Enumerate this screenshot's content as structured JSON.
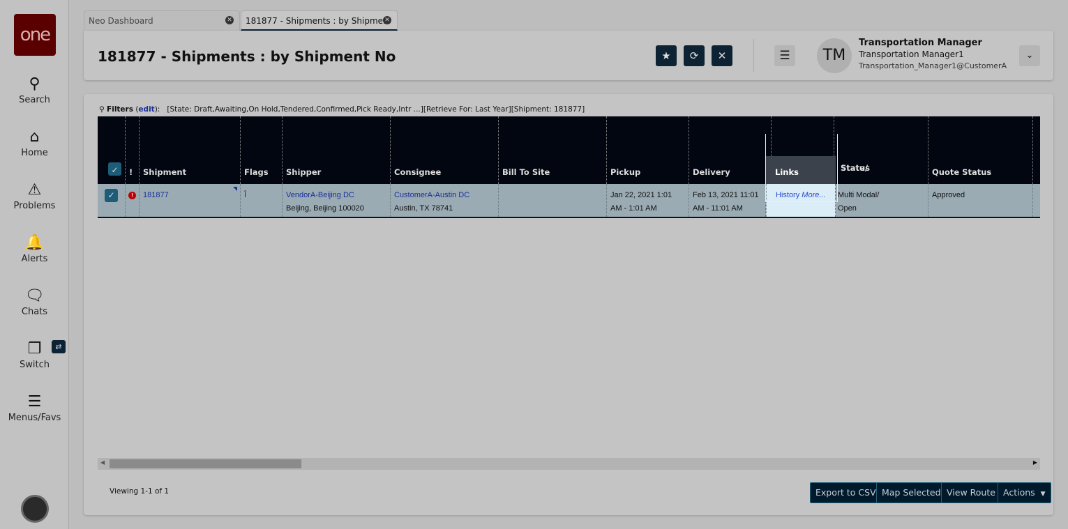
{
  "logo": "one",
  "sidebar": {
    "items": [
      {
        "label": "Search",
        "icon": "search-icon"
      },
      {
        "label": "Home",
        "icon": "home-icon"
      },
      {
        "label": "Problems",
        "icon": "warning-icon"
      },
      {
        "label": "Alerts",
        "icon": "bell-icon"
      },
      {
        "label": "Chats",
        "icon": "chat-icon"
      },
      {
        "label": "Switch",
        "icon": "switch-icon"
      },
      {
        "label": "Menus/Favs",
        "icon": "menu-icon"
      }
    ]
  },
  "tabs": [
    {
      "label": "Neo Dashboard"
    },
    {
      "label": "181877 - Shipments : by Shipme..."
    }
  ],
  "header": {
    "title": "181877 - Shipments : by Shipment No",
    "user": {
      "initials": "TM",
      "name": "Transportation Manager",
      "role": "Transportation Manager1",
      "email": "Transportation_Manager1@CustomerA"
    }
  },
  "filters": {
    "label": "Filters",
    "edit": "edit",
    "text": "[State: Draft,Awaiting,On Hold,Tendered,Confirmed,Pick Ready,Intr ...][Retrieve For: Last Year][Shipment: 181877]"
  },
  "table": {
    "columns": [
      "!",
      "Shipment",
      "Flags",
      "Shipper",
      "Consignee",
      "Bill To Site",
      "Pickup",
      "Delivery",
      "Links",
      "State/",
      "Status",
      "Quote Status"
    ],
    "rows": [
      {
        "shipment": "181877",
        "shipper": "VendorA-Beijing DC",
        "shipper_addr": "Beijing, Beijing 100020",
        "consignee": "CustomerA-Austin DC",
        "consignee_addr": "Austin, TX 78741",
        "bill_to": "",
        "pickup1": "Jan 22, 2021 1:01",
        "pickup2": "AM - 1:01 AM",
        "delivery1": "Feb 13, 2021 11:01",
        "delivery2": "AM - 11:01 AM",
        "link_history": "History",
        "link_more": "More...",
        "state1": "Multi Modal/",
        "state2": "Open",
        "quote_status": "Approved"
      }
    ]
  },
  "footer": {
    "viewing": "Viewing 1-1 of 1",
    "buttons": [
      "Export to CSV",
      "Map Selected",
      "View Route",
      "Actions"
    ]
  }
}
